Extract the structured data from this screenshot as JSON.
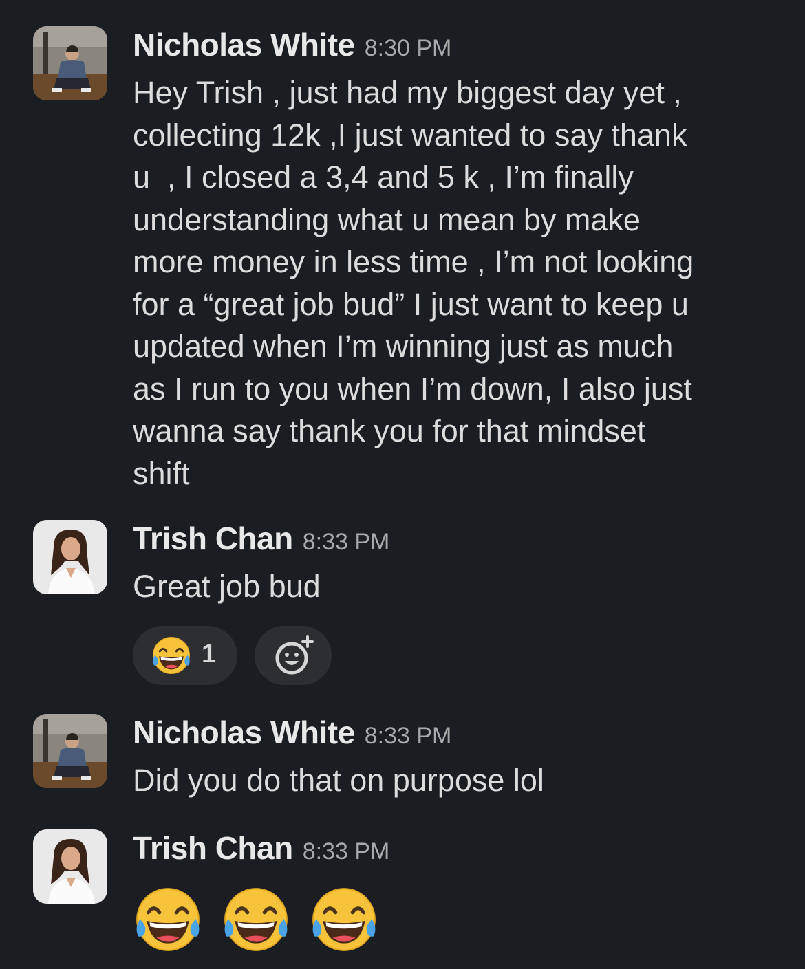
{
  "messages": [
    {
      "author": "Nicholas White",
      "time": "8:30 PM",
      "avatar": "nicholas-avatar",
      "lines": [
        "Hey Trish , just had my biggest day yet ,",
        "collecting 12k ,I just wanted to say thank",
        "u  , I closed a 3,4 and 5 k , I’m finally",
        "understanding what u mean by make",
        "more money in less time , I’m not looking",
        "for a “great job bud” I just want to keep u",
        "updated when I’m winning just as much",
        "as I run to you when I’m down, I also just",
        "wanna say thank you for that mindset",
        "shift"
      ]
    },
    {
      "author": "Trish Chan",
      "time": "8:33 PM",
      "avatar": "trish-avatar",
      "text": "Great job bud",
      "reactions": [
        {
          "emoji": "face-with-tears-of-joy-icon",
          "count": "1"
        }
      ],
      "add_reaction_icon": "add-reaction-icon"
    },
    {
      "author": "Nicholas White",
      "time": "8:33 PM",
      "avatar": "nicholas-avatar",
      "text": "Did you do that on purpose lol"
    },
    {
      "author": "Trish Chan",
      "time": "8:33 PM",
      "avatar": "trish-avatar",
      "emojis": [
        "face-with-tears-of-joy-icon",
        "face-with-tears-of-joy-icon",
        "face-with-tears-of-joy-icon"
      ]
    }
  ],
  "colors": {
    "background": "#1a1d21",
    "name": "#e8e8e8",
    "text": "#dcdcdd",
    "timestamp": "#a9a9ab",
    "reaction_pill": "#2c2e32",
    "emoji_yellow": "#f6c33b",
    "tear_blue": "#4aa3e6"
  }
}
